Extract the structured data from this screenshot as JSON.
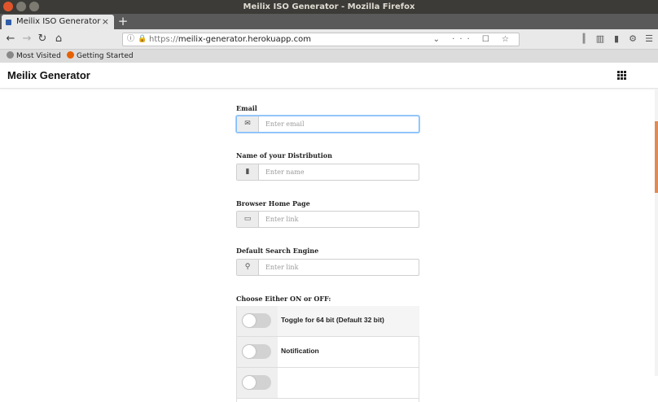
{
  "window": {
    "title": "Meilix ISO Generator - Mozilla Firefox"
  },
  "tabs": [
    {
      "label": "Meilix ISO Generator",
      "close": "×"
    }
  ],
  "new_tab_label": "+",
  "url": {
    "scheme": "https://",
    "host": "meilix-generator.herokuapp.com"
  },
  "bookmarks": [
    {
      "label": "Most Visited"
    },
    {
      "label": "Getting Started"
    }
  ],
  "app": {
    "title": "Meilix Generator"
  },
  "form": {
    "email": {
      "label": "Email",
      "placeholder": "Enter email",
      "icon": "envelope-icon"
    },
    "distro": {
      "label": "Name of your Distribution",
      "placeholder": "Enter name",
      "icon": "id-card-icon"
    },
    "homepage": {
      "label": "Browser Home Page",
      "placeholder": "Enter link",
      "icon": "browser-window-icon"
    },
    "search": {
      "label": "Default Search Engine",
      "placeholder": "Enter link",
      "icon": "search-icon"
    },
    "toggles_label": "Choose Either ON or OFF:",
    "toggles": [
      {
        "label": "Toggle for 64 bit (Default 32 bit)",
        "on": false
      },
      {
        "label": "Notification",
        "on": false
      },
      {
        "label": "",
        "on": false
      }
    ]
  },
  "colors": {
    "focus_border": "#80bdff",
    "scroll_thumb": "#e08a55",
    "titlebar": "#3c3b37"
  }
}
